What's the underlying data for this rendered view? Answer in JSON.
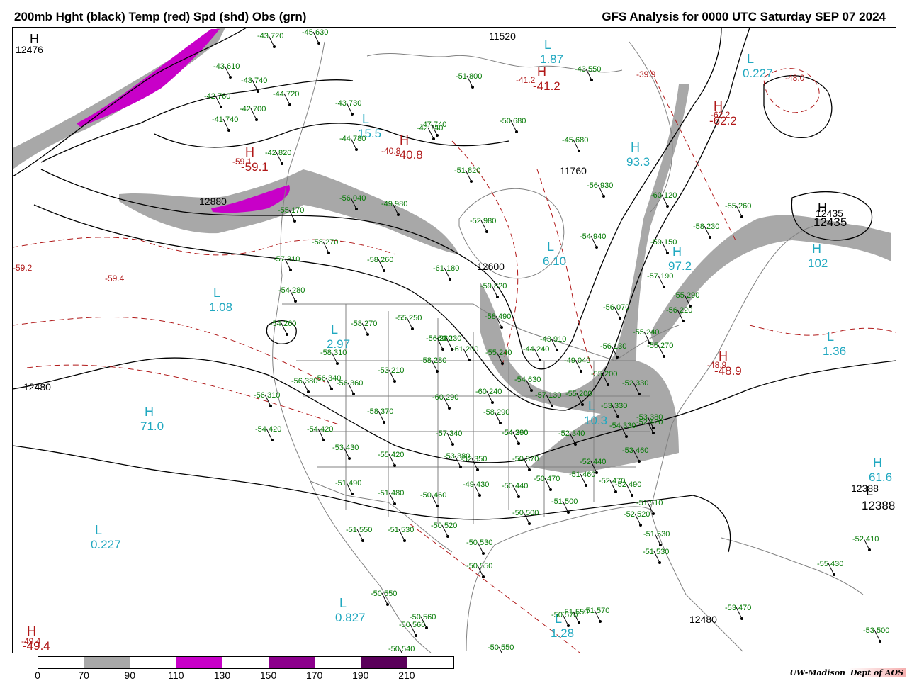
{
  "header": {
    "left_title": "200mb Hght (black) Temp (red) Spd (shd) Obs (grn)",
    "right_title": "GFS Analysis for 0000 UTC Saturday  SEP 07 2024"
  },
  "colors": {
    "height": "#000000",
    "temp": "#b01818",
    "speed_label": "#20a8c0",
    "obs": "#007800",
    "border": "#808080",
    "shade_70": "#a8a8a8",
    "shade_110": "#c800c8",
    "shade_150": "#8c008c",
    "shade_190": "#5a005a"
  },
  "legend": {
    "ticks": [
      "0",
      "70",
      "90",
      "110",
      "130",
      "150",
      "170",
      "190",
      "210"
    ],
    "colors": [
      "#ffffff",
      "#a8a8a8",
      "#ffffff",
      "#c800c8",
      "#ffffff",
      "#8c008c",
      "#ffffff",
      "#5a005a",
      "#ffffff"
    ]
  },
  "credit": {
    "left": "UW-Madison",
    "right": "Dept of AOS"
  },
  "map": {
    "height_labels": [
      "12476",
      "12600",
      "12480",
      "11760",
      "11520",
      "12880",
      "12435",
      "12388",
      "12480"
    ],
    "temp_labels": [
      "-59.4",
      "-59.1",
      "-40.8",
      "-41.2",
      "-39.9",
      "-62.2",
      "-48.0",
      "-48.9",
      "-49.4",
      "-59.2"
    ],
    "pressure_centers": [
      {
        "type": "H",
        "value": "",
        "kind": "height"
      },
      {
        "type": "H",
        "value": "-59.1",
        "kind": "temp"
      },
      {
        "type": "H",
        "value": "-40.8",
        "kind": "temp"
      },
      {
        "type": "H",
        "value": "-41.2",
        "kind": "temp"
      },
      {
        "type": "H",
        "value": "-62.2",
        "kind": "temp"
      },
      {
        "type": "H",
        "value": "-48.9",
        "kind": "temp"
      },
      {
        "type": "H",
        "value": "-49.4",
        "kind": "temp"
      },
      {
        "type": "L",
        "value": "1.87",
        "kind": "speed"
      },
      {
        "type": "L",
        "value": "0.227",
        "kind": "speed"
      },
      {
        "type": "L",
        "value": "15.5",
        "kind": "speed"
      },
      {
        "type": "L",
        "value": "1.08",
        "kind": "speed"
      },
      {
        "type": "L",
        "value": "2.97",
        "kind": "speed"
      },
      {
        "type": "L",
        "value": "6.10",
        "kind": "speed"
      },
      {
        "type": "L",
        "value": "1.36",
        "kind": "speed"
      },
      {
        "type": "H",
        "value": "71.0",
        "kind": "speed"
      },
      {
        "type": "L",
        "value": "0.227",
        "kind": "speed"
      },
      {
        "type": "L",
        "value": "0.827",
        "kind": "speed"
      },
      {
        "type": "L",
        "value": "1.28",
        "kind": "speed"
      },
      {
        "type": "H",
        "value": "61.6",
        "kind": "speed"
      },
      {
        "type": "H",
        "value": "102",
        "kind": "speed"
      },
      {
        "type": "H",
        "value": "12435",
        "kind": "height"
      },
      {
        "type": "L",
        "value": "12388",
        "kind": "height"
      },
      {
        "type": "H",
        "value": "93.3",
        "kind": "speed"
      },
      {
        "type": "H",
        "value": "97.2",
        "kind": "speed"
      },
      {
        "type": "L",
        "value": "10.3",
        "kind": "speed"
      }
    ],
    "obs": [
      "-45 630",
      "-43 720",
      "-43 610",
      "-43 740",
      "-44 720",
      "-42 760",
      "-42 700",
      "-41 740",
      "-43 730",
      "-44 780",
      "-42 740",
      "-47 740",
      "-51 800",
      "-50 680",
      "-45 680",
      "-43 550",
      "-42 820",
      "-51 820",
      "-56 930",
      "-60 120",
      "-58 230",
      "-55 260",
      "-56 040",
      "-49 980",
      "-52 980",
      "-55 170",
      "-58 270",
      "-58 260",
      "-61 180",
      "-57 310",
      "-54 280",
      "-59 820",
      "-54 940",
      "-59 150",
      "-57 190",
      "-55 290",
      "-56 070",
      "-56 220",
      "-54 260",
      "-58 310",
      "-58 270",
      "-55 250",
      "-56 280",
      "-58 490",
      "-60 230",
      "-61 200",
      "-55 240",
      "-44 240",
      "-43 910",
      "-49 040",
      "-56 130",
      "-55 240",
      "-55 270",
      "-53 210",
      "-58 280",
      "-56 340",
      "-56 360",
      "-56 380",
      "-56 310",
      "-58 370",
      "-60 290",
      "-60 240",
      "-54 630",
      "-57 130",
      "-55 200",
      "-55 200",
      "-58 290",
      "-54 300",
      "-53 330",
      "-54 330",
      "-52 330",
      "-53 380",
      "-52 420",
      "-54 420",
      "-54 420",
      "-53 430",
      "-55 420",
      "-57 340",
      "-54 290",
      "-52 350",
      "-53 380",
      "-52 340",
      "-53 460",
      "-52 440",
      "-51 460",
      "-50 370",
      "-52 470",
      "-51 490",
      "-51 480",
      "-50 460",
      "-49 430",
      "-50 440",
      "-50 470",
      "-52 490",
      "-51 510",
      "-51 500",
      "-50 500",
      "-52 520",
      "-51 530",
      "-51 530",
      "-51 550",
      "-51 530",
      "-50 520",
      "-50 530",
      "-50 550",
      "-51 570",
      "-50 550",
      "-50 560",
      "-50 540",
      "-50 560",
      "-50 550",
      "-50 570",
      "-51 550",
      "-53 470",
      "-55 430",
      "-52 410",
      "-53 500"
    ]
  }
}
